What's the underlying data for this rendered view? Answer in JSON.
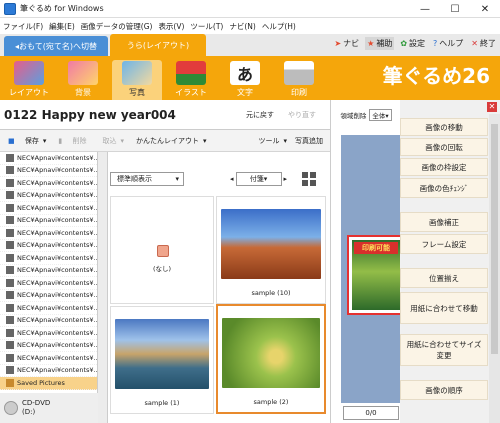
{
  "app": {
    "title": "筆ぐるめ for Windows",
    "brand": "筆ぐるめ26"
  },
  "window_buttons": [
    "—",
    "☐",
    "✕"
  ],
  "menu": [
    "ファイル(F)",
    "編集(E)",
    "画像データの管理(G)",
    "表示(V)",
    "ツール(T)",
    "ナビ(N)",
    "ヘルプ(H)"
  ],
  "tabs": {
    "front": "おもて(宛て名)へ切替",
    "back": "うら(レイアウト)"
  },
  "top_right": [
    {
      "label": "ナビ",
      "icon": "pointer-icon"
    },
    {
      "label": "補助",
      "icon": "star-icon"
    },
    {
      "label": "設定",
      "icon": "gear-icon"
    },
    {
      "label": "ヘルプ",
      "icon": "help-icon"
    },
    {
      "label": "終了",
      "icon": "close-icon"
    }
  ],
  "tools": [
    "レイアウト",
    "背景",
    "写真",
    "イラスト",
    "文字",
    "印刷"
  ],
  "document": {
    "title": "0122  Happy new year004",
    "undo": "元に戻す",
    "redo": "やり直す"
  },
  "subtoolbar": {
    "save": "保存",
    "delete": "削除",
    "import": "取込",
    "layout": "かんたんレイアウト",
    "tools": "ツール",
    "add_photo": "写真追加"
  },
  "left_list": {
    "items": [
      "NEC¥Apnavi¥contents¥...",
      "NEC¥Apnavi¥contents¥...",
      "NEC¥Apnavi¥contents¥...",
      "NEC¥Apnavi¥contents¥...",
      "NEC¥Apnavi¥contents¥...",
      "NEC¥Apnavi¥contents¥...",
      "NEC¥Apnavi¥contents¥...",
      "NEC¥Apnavi¥contents¥...",
      "NEC¥Apnavi¥contents¥...",
      "NEC¥Apnavi¥contents¥...",
      "NEC¥Apnavi¥contents¥...",
      "NEC¥Apnavi¥contents¥...",
      "NEC¥Apnavi¥contents¥...",
      "NEC¥Apnavi¥contents¥...",
      "NEC¥Apnavi¥contents¥...",
      "NEC¥Apnavi¥contents¥...",
      "NEC¥Apnavi¥contents¥...",
      "NEC¥Apnavi¥contents¥..."
    ],
    "selected": "Saved Pictures",
    "drive": "CD-DVD\n(D:)"
  },
  "photos": {
    "sort": "標準順表示",
    "nav": "付箋",
    "cells": [
      "(なし)",
      "sample (10)",
      "sample (1)",
      "sample (2)"
    ]
  },
  "canvas": {
    "delete_area": "領域削除",
    "zoom": "全体",
    "banner": "印刷可能",
    "page": "0/0"
  },
  "right_panel": [
    "画像の移動",
    "画像の回転",
    "画像の枠設定",
    "画像の色ﾁｪﾝｼﾞ",
    "画像補正",
    "フレーム設定",
    "位置揃え",
    "用紙に合わせて移動",
    "用紙に合わせてサイズ変更",
    "画像の順序"
  ],
  "colors": {
    "orange": "#f5a60b",
    "blue": "#4a8fd6",
    "selection": "#e88a2d"
  }
}
